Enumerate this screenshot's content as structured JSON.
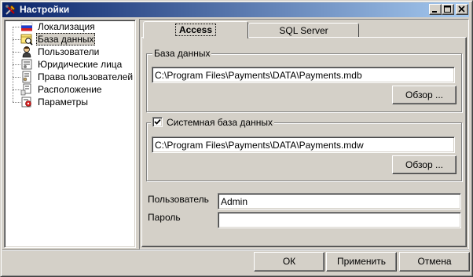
{
  "window": {
    "title": "Настройки",
    "icon": "tools-icon"
  },
  "sidebar": {
    "items": [
      {
        "label": "Локализация",
        "icon": "flag-icon",
        "selected": false
      },
      {
        "label": "База данных",
        "icon": "database-icon",
        "selected": true
      },
      {
        "label": "Пользователи",
        "icon": "user-icon",
        "selected": false
      },
      {
        "label": "Юридические лица",
        "icon": "company-icon",
        "selected": false
      },
      {
        "label": "Права пользователей",
        "icon": "rights-icon",
        "selected": false
      },
      {
        "label": "Расположение",
        "icon": "location-icon",
        "selected": false
      },
      {
        "label": "Параметры",
        "icon": "settings-icon",
        "selected": false
      }
    ]
  },
  "tabs": [
    {
      "label": "Access",
      "active": true
    },
    {
      "label": "SQL Server",
      "active": false
    }
  ],
  "database_group": {
    "title": "База данных",
    "path": "C:\\Program Files\\Payments\\DATA\\Payments.mdb",
    "browse_label": "Обзор ..."
  },
  "system_db_group": {
    "title": "Системная база данных",
    "checked": true,
    "path": "C:\\Program Files\\Payments\\DATA\\Payments.mdw",
    "browse_label": "Обзор ..."
  },
  "credentials": {
    "user_label": "Пользователь",
    "user_value": "Admin",
    "password_label": "Пароль",
    "password_value": ""
  },
  "footer": {
    "ok_label": "ОК",
    "apply_label": "Применить",
    "cancel_label": "Отмена"
  }
}
